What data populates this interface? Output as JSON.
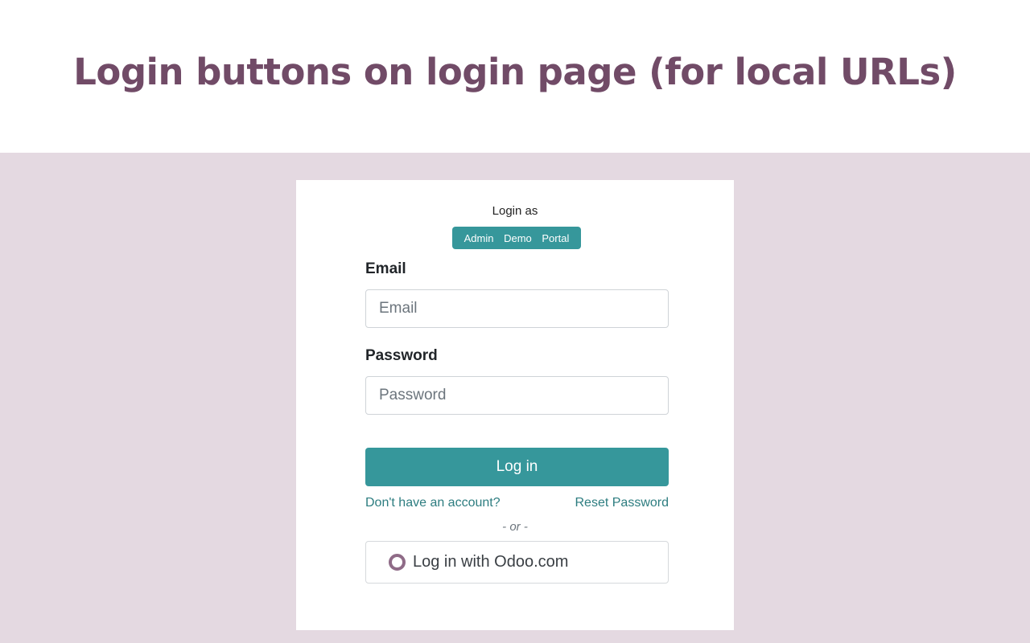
{
  "header": {
    "title": "Login buttons on login page (for local URLs)"
  },
  "login_card": {
    "login_as_label": "Login as",
    "quick_login": [
      "Admin",
      "Demo",
      "Portal"
    ],
    "email": {
      "label": "Email",
      "placeholder": "Email",
      "value": ""
    },
    "password": {
      "label": "Password",
      "placeholder": "Password",
      "value": ""
    },
    "login_button": "Log in",
    "signup_link": "Don't have an account?",
    "reset_link": "Reset Password",
    "separator": "- or -",
    "oauth_button": {
      "label": "Log in with Odoo.com",
      "icon": "odoo-circle-icon"
    }
  },
  "colors": {
    "brand_purple": "#714B67",
    "teal": "#36979b",
    "stage_background": "#e4d9e1"
  }
}
